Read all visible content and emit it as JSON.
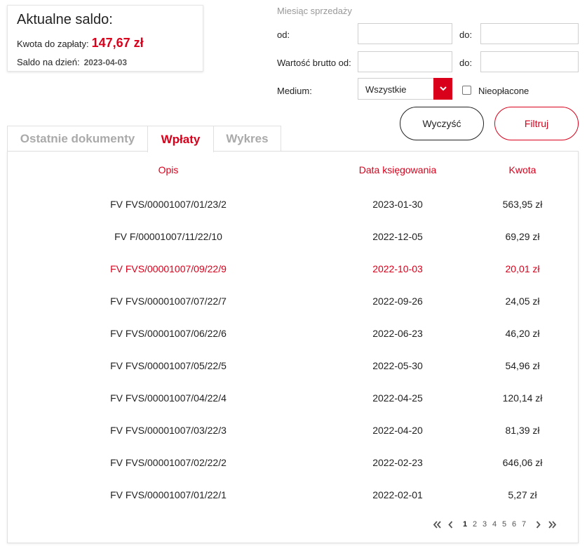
{
  "balance": {
    "title": "Aktualne saldo:",
    "amount_label": "Kwota do zapłaty:",
    "amount_value": "147,67 zł",
    "date_label": "Saldo na dzień:",
    "date_value": "2023-04-03"
  },
  "filters": {
    "section_label": "Miesiąc sprzedaży",
    "from_label": "od:",
    "to_label": "do:",
    "gross_from_label": "Wartość brutto od:",
    "gross_to_label": "do:",
    "month_from_value": "",
    "month_to_value": "",
    "gross_from_value": "",
    "gross_to_value": "",
    "medium_label": "Medium:",
    "medium_selected": "Wszystkie",
    "unpaid_label": "Nieopłacone",
    "unpaid_checked": false,
    "clear_button": "Wyczyść",
    "filter_button": "Filtruj"
  },
  "tabs": [
    {
      "label": "Ostatnie dokumenty",
      "active": false
    },
    {
      "label": "Wpłaty",
      "active": true
    },
    {
      "label": "Wykres",
      "active": false
    }
  ],
  "table": {
    "headers": {
      "description": "Opis",
      "date": "Data księgowania",
      "amount": "Kwota"
    },
    "rows": [
      {
        "description": "FV FVS/00001007/01/23/2",
        "date": "2023-01-30",
        "amount": "563,95 zł",
        "highlight": false
      },
      {
        "description": "FV F/00001007/11/22/10",
        "date": "2022-12-05",
        "amount": "69,29 zł",
        "highlight": false
      },
      {
        "description": "FV FVS/00001007/09/22/9",
        "date": "2022-10-03",
        "amount": "20,01 zł",
        "highlight": true
      },
      {
        "description": "FV FVS/00001007/07/22/7",
        "date": "2022-09-26",
        "amount": "24,05 zł",
        "highlight": false
      },
      {
        "description": "FV FVS/00001007/06/22/6",
        "date": "2022-06-23",
        "amount": "46,20 zł",
        "highlight": false
      },
      {
        "description": "FV FVS/00001007/05/22/5",
        "date": "2022-05-30",
        "amount": "54,96 zł",
        "highlight": false
      },
      {
        "description": "FV FVS/00001007/04/22/4",
        "date": "2022-04-25",
        "amount": "120,14 zł",
        "highlight": false
      },
      {
        "description": "FV FVS/00001007/03/22/3",
        "date": "2022-04-20",
        "amount": "81,39 zł",
        "highlight": false
      },
      {
        "description": "FV FVS/00001007/02/22/2",
        "date": "2022-02-23",
        "amount": "646,06 zł",
        "highlight": false
      },
      {
        "description": "FV FVS/00001007/01/22/1",
        "date": "2022-02-01",
        "amount": "5,27 zł",
        "highlight": false
      }
    ]
  },
  "pagination": {
    "pages": [
      "1",
      "2",
      "3",
      "4",
      "5",
      "6",
      "7"
    ],
    "current": "1",
    "icons": [
      "first-page-icon",
      "prev-page-icon",
      "next-page-icon",
      "last-page-icon"
    ]
  },
  "colors": {
    "accent": "#d9001b",
    "text": "#222222",
    "muted": "#999999",
    "border": "#e0e0e0"
  }
}
